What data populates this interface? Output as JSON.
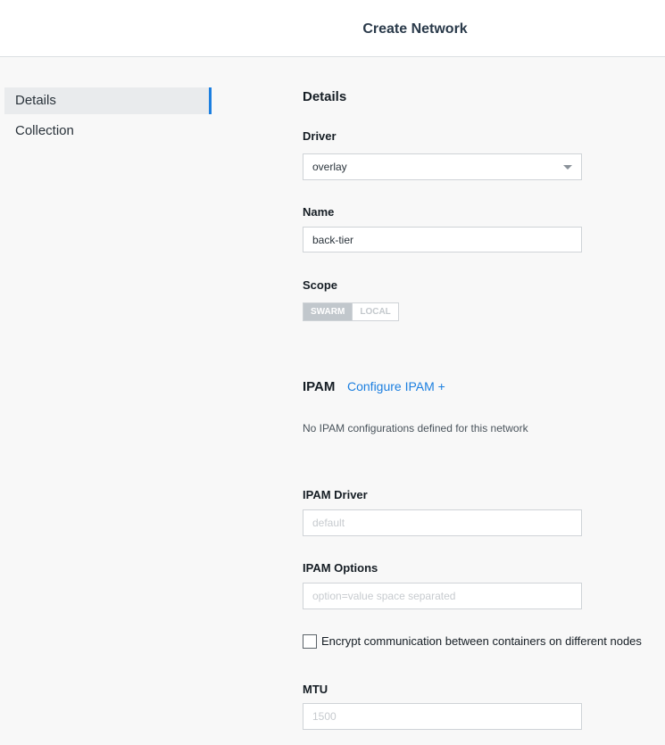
{
  "header": {
    "title": "Create Network"
  },
  "sidebar": {
    "items": [
      {
        "label": "Details"
      },
      {
        "label": "Collection"
      }
    ]
  },
  "details": {
    "section_title": "Details",
    "driver": {
      "label": "Driver",
      "value": "overlay"
    },
    "name": {
      "label": "Name",
      "value": "back-tier"
    },
    "scope": {
      "label": "Scope",
      "options": [
        "SWARM",
        "LOCAL"
      ],
      "selected": "SWARM"
    }
  },
  "ipam": {
    "section_title": "IPAM",
    "configure_link": "Configure IPAM +",
    "empty_note": "No IPAM configurations defined for this network",
    "driver": {
      "label": "IPAM Driver",
      "placeholder": "default"
    },
    "options": {
      "label": "IPAM Options",
      "placeholder": "option=value space separated"
    }
  },
  "encrypt": {
    "label": "Encrypt communication between containers on different nodes",
    "checked": false
  },
  "mtu": {
    "label": "MTU",
    "placeholder": "1500"
  }
}
